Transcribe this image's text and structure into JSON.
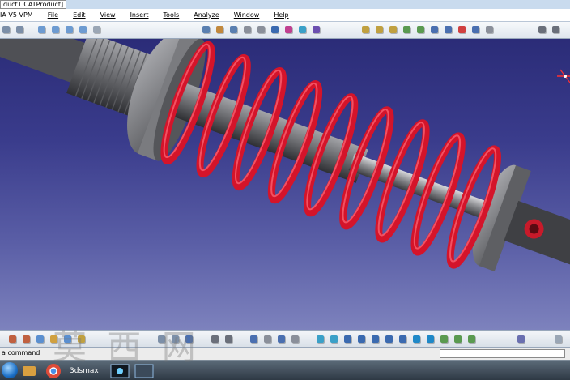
{
  "window": {
    "title": "duct1.CATProduct]"
  },
  "menu": {
    "app_label": "IA V5 VPM",
    "items": [
      "File",
      "Edit",
      "View",
      "Insert",
      "Tools",
      "Analyze",
      "Window",
      "Help"
    ]
  },
  "viewport": {
    "model": "coilover-shock-absorber-assembly"
  },
  "status": {
    "prompt": "a command",
    "command_value": ""
  },
  "taskbar": {
    "site_text": "3dsmax"
  },
  "watermark": {
    "text": "莫 西 网"
  },
  "colors": {
    "background_top": "#2b2c78",
    "background_bottom": "#7d82bd",
    "spring": "#d4142a",
    "metal": "#8e8f92"
  }
}
